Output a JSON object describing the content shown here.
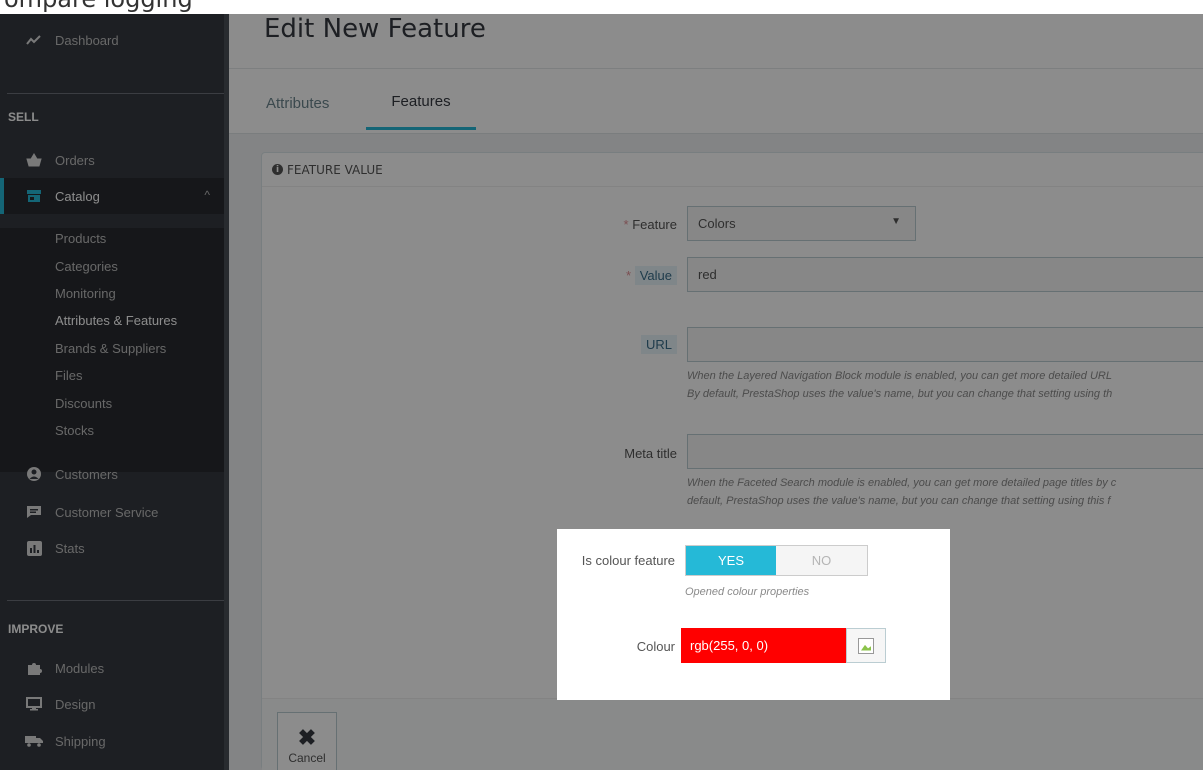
{
  "top_caption": "ompare logging",
  "sidebar": {
    "items": [
      {
        "label": "Dashboard",
        "icon": "trending-up-icon"
      },
      {
        "label": "Orders",
        "icon": "basket-icon"
      },
      {
        "label": "Catalog",
        "icon": "store-icon"
      },
      {
        "label": "Customers",
        "icon": "user-circle-icon"
      },
      {
        "label": "Customer Service",
        "icon": "chat-icon"
      },
      {
        "label": "Stats",
        "icon": "bar-chart-icon"
      },
      {
        "label": "Modules",
        "icon": "puzzle-icon"
      },
      {
        "label": "Design",
        "icon": "monitor-icon"
      },
      {
        "label": "Shipping",
        "icon": "truck-icon"
      }
    ],
    "sections": {
      "sell": "SELL",
      "improve": "IMPROVE"
    },
    "catalog_sub": [
      "Products",
      "Categories",
      "Monitoring",
      "Attributes & Features",
      "Brands & Suppliers",
      "Files",
      "Discounts",
      "Stocks"
    ]
  },
  "header": {
    "title": "Edit New Feature",
    "tabs": [
      "Attributes",
      "Features"
    ]
  },
  "panel": {
    "heading": "FEATURE VALUE",
    "feature_label": "Feature",
    "feature_value": "Colors",
    "value_label": "Value",
    "value_value": "red",
    "url_label": "URL",
    "url_value": "",
    "url_help_1": "When the Layered Navigation Block module is enabled, you can get more detailed URL",
    "url_help_2": "By default, PrestaShop uses the value's name, but you can change that setting using th",
    "meta_label": "Meta title",
    "meta_value": "",
    "meta_help_1": "When the Faceted Search module is enabled, you can get more detailed page titles by c",
    "meta_help_2": "default, PrestaShop uses the value's name, but you can change that setting using this f",
    "colour_feature_label": "Is colour feature",
    "yes": "YES",
    "no": "NO",
    "colour_help": "Opened colour properties",
    "colour_label": "Colour",
    "colour_value": "rgb(255, 0, 0)",
    "cancel": "Cancel"
  },
  "colors": {
    "accent": "#25b9d7",
    "sidebar": "#363a41",
    "swatch": "#ff0000"
  }
}
